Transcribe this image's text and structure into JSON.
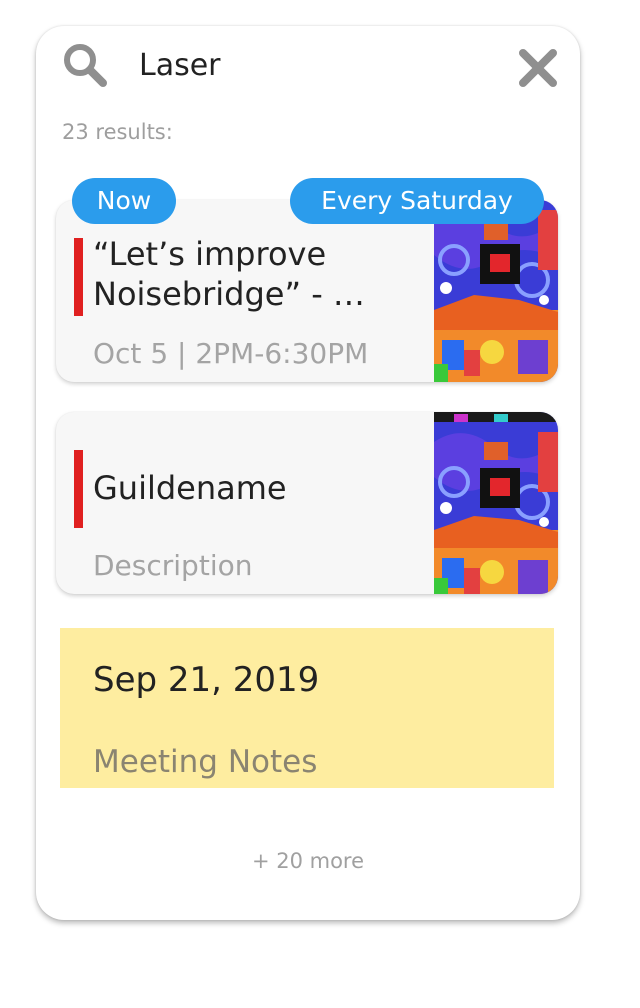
{
  "search": {
    "query": "Laser",
    "search_icon": "search-icon",
    "clear_icon": "close-icon"
  },
  "results": {
    "count_label": "23 results:",
    "more_label": "+ 20 more"
  },
  "events": [
    {
      "title": "“Let’s improve Noisebridge” - …",
      "subtitle": "Oct 5 | 2PM-6:30PM",
      "badges": [
        "Now",
        "Every Saturday"
      ],
      "accent_color": "#e02020"
    },
    {
      "title": "Guildename",
      "subtitle": "Description",
      "accent_color": "#e02020"
    }
  ],
  "note": {
    "date": "Sep 21, 2019",
    "description": "Meeting Notes",
    "background": "#feeda0"
  },
  "colors": {
    "badge": "#2b9cec",
    "accent": "#e02020",
    "icon_gray": "#8f8f8f"
  }
}
